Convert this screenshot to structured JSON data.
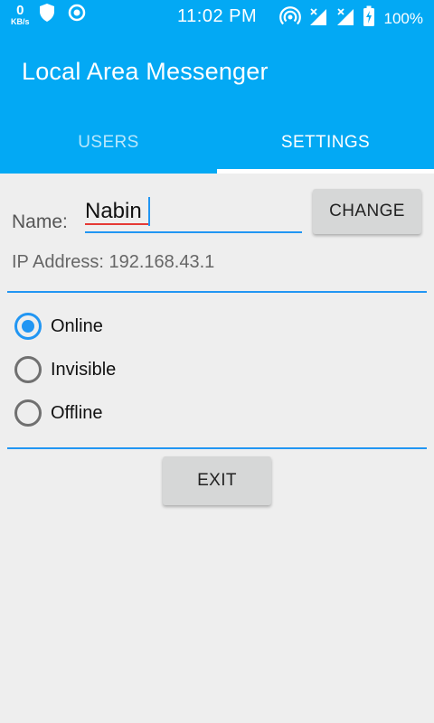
{
  "status_bar": {
    "net_speed_value": "0",
    "net_speed_unit": "KB/s",
    "time": "11:02 PM",
    "battery": "100%",
    "icons": [
      "shield-icon",
      "record-icon",
      "hotspot-icon",
      "signal-icon",
      "signal-icon",
      "battery-charging-icon"
    ]
  },
  "app_bar": {
    "title": "Local Area Messenger",
    "tabs": [
      {
        "label": "USERS",
        "selected": false
      },
      {
        "label": "SETTINGS",
        "selected": true
      }
    ]
  },
  "settings": {
    "name_label": "Name:",
    "name_value": "Nabin",
    "change_button": "CHANGE",
    "ip_text": "IP Address: 192.168.43.1",
    "status_options": [
      {
        "label": "Online",
        "checked": true
      },
      {
        "label": "Invisible",
        "checked": false
      },
      {
        "label": "Offline",
        "checked": false
      }
    ],
    "exit_button": "EXIT"
  },
  "colors": {
    "primary": "#03A9F4",
    "accent": "#2196F3",
    "background": "#EEEEEE",
    "spell_error": "#E53935"
  }
}
